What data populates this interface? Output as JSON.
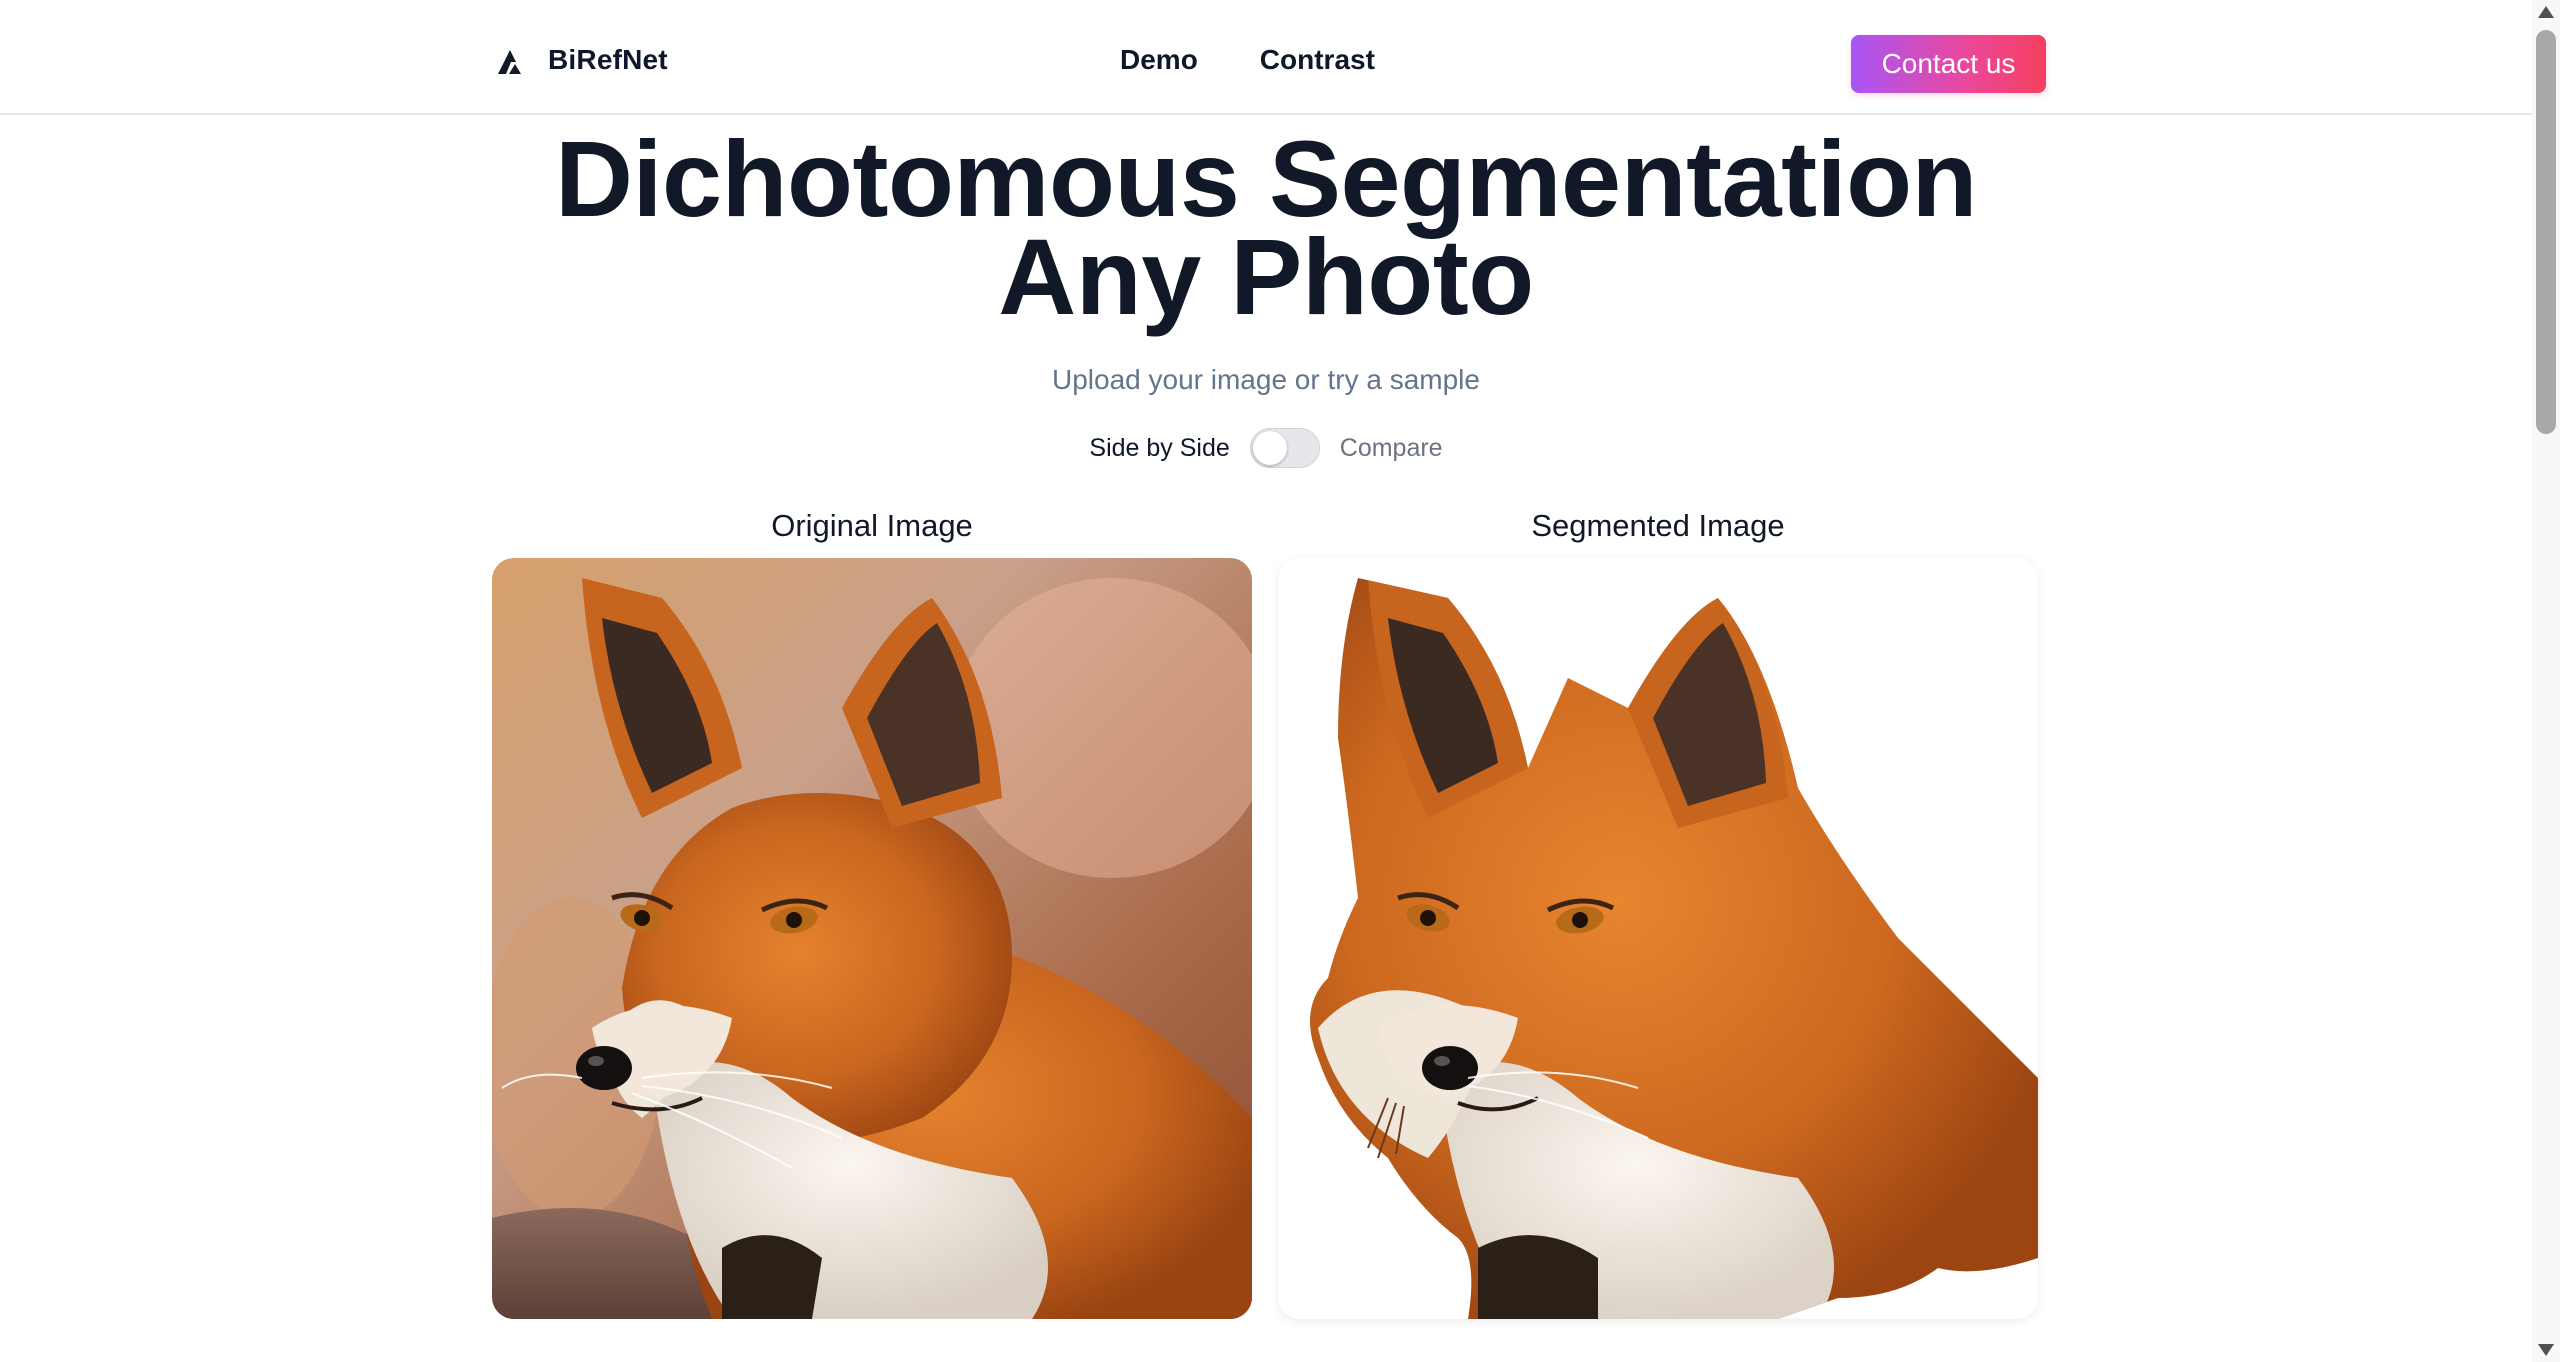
{
  "brand": {
    "name": "BiRefNet",
    "logo_icon": "birefnet-logo-icon"
  },
  "nav": {
    "items": [
      "Demo",
      "Contrast"
    ]
  },
  "header": {
    "contact_label": "Contact us",
    "accent_from": "#a855f7",
    "accent_to": "#f43f5e"
  },
  "hero": {
    "title_line1": "Dichotomous Segmentation",
    "title_line2": "Any Photo",
    "subtitle": "Upload your image or try a sample"
  },
  "view_toggle": {
    "left_label": "Side by Side",
    "right_label": "Compare",
    "compare_enabled": false
  },
  "panels": {
    "original_label": "Original Image",
    "segmented_label": "Segmented Image",
    "original_image": "fox-photo",
    "segmented_image": "fox-cutout"
  }
}
